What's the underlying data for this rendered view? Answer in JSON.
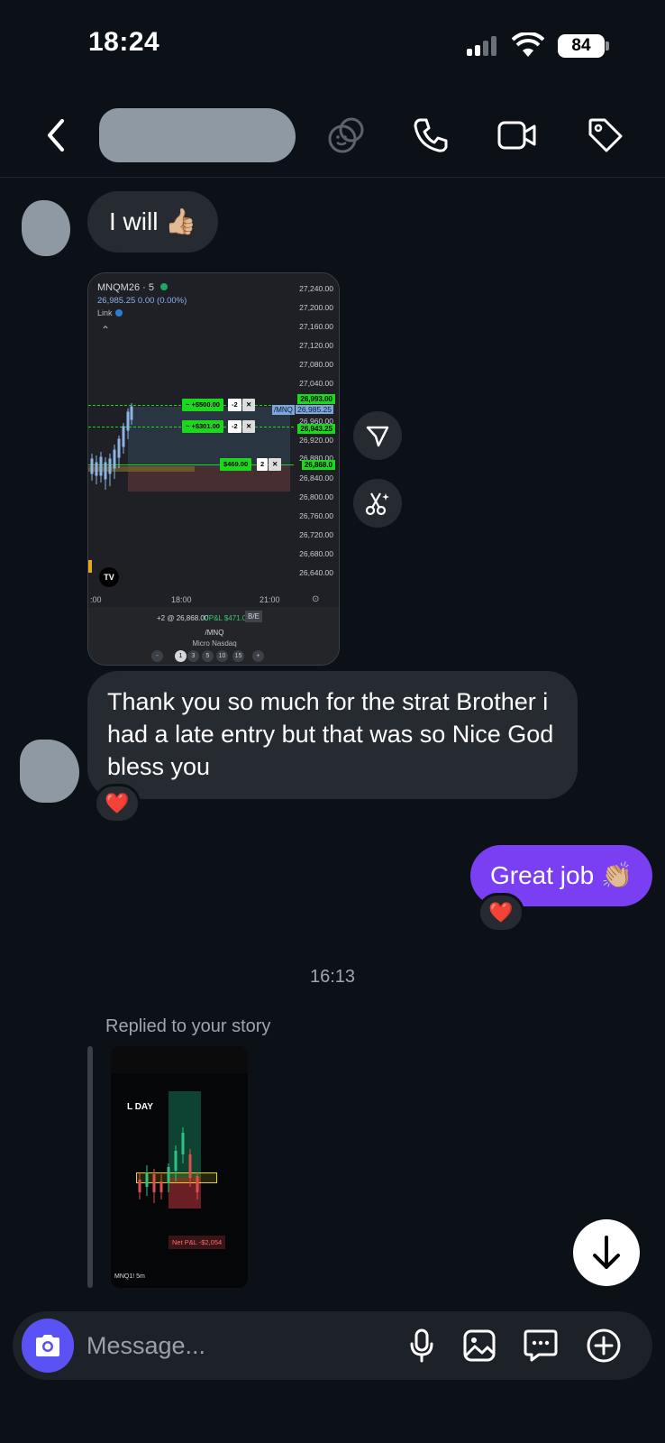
{
  "status_bar": {
    "time": "18:24",
    "battery": "84"
  },
  "header": {
    "icons": [
      "back-icon",
      "effects-icon",
      "phone-icon",
      "video-icon",
      "tag-icon"
    ]
  },
  "messages": {
    "msg1": {
      "text": "I will 👍🏼"
    },
    "chart": {
      "symbol": "MNQM26 · 5",
      "quote": "26,985.25  0.00 (0.00%)",
      "link": "Link",
      "prices": [
        "27,240.00",
        "27,200.00",
        "27,160.00",
        "27,120.00",
        "27,080.00",
        "27,040.00",
        "26,993.00",
        "26,985.25",
        "26,960.00",
        "26,943.25",
        "26,920.00",
        "26,880.00",
        "26,868.0",
        "26,840.00",
        "26,800.00",
        "26,760.00",
        "26,720.00",
        "26,680.00",
        "26,640.00"
      ],
      "orders": [
        {
          "label": "~ +$500.00",
          "qty": "-2"
        },
        {
          "label": "~ +$301.00",
          "qty": "-2"
        },
        {
          "label": "$469.00",
          "qty": "2"
        }
      ],
      "tag": "/MNQ",
      "x_ticks": [
        ":00",
        "18:00",
        "21:00"
      ],
      "position_line": "+2 @ 26,868.00",
      "upl": "UP&L $471.00",
      "be": "B/E",
      "instrument": "/MNQ",
      "instrument_name": "Micro Nasdaq",
      "qty_options": [
        "-",
        "1",
        "3",
        "5",
        "10",
        "15",
        "+"
      ]
    },
    "msg2": {
      "text": "Thank you so much for the strat Brother i had a late entry but that was so Nice God bless you",
      "reaction": "❤️"
    },
    "msg3": {
      "text": "Great job 👏🏼",
      "reaction": "❤️"
    },
    "timestamp": "16:13",
    "replied_label": "Replied to your story",
    "story": {
      "caption": "L DAY",
      "pnl": "Net P&L -$2,054",
      "bottom": "MNQ1!   5m"
    }
  },
  "composer": {
    "placeholder": "Message..."
  },
  "colors": {
    "background": "#0c1017",
    "incoming": "#262a31",
    "outgoing": "#7a3ff2",
    "camera": "#5b52f5"
  }
}
